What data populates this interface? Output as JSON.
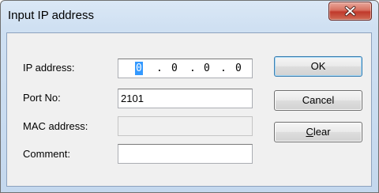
{
  "window": {
    "title": "Input IP address"
  },
  "form": {
    "ip_label": "IP address:",
    "ip_segments": [
      "0",
      "0",
      "0",
      "0"
    ],
    "ip_separator": ".",
    "port_label": "Port No:",
    "port_value": "2101",
    "mac_label": "MAC address:",
    "mac_value": "",
    "comment_label": "Comment:",
    "comment_value": ""
  },
  "buttons": {
    "ok_label": "OK",
    "cancel_label": "Cancel",
    "clear_mnemonic": "C",
    "clear_rest": "lear"
  },
  "icons": {
    "close": "close-icon"
  },
  "colors": {
    "close_button": "#c0392b",
    "selection": "#3399ff",
    "default_button_border": "#3c7fb1"
  }
}
